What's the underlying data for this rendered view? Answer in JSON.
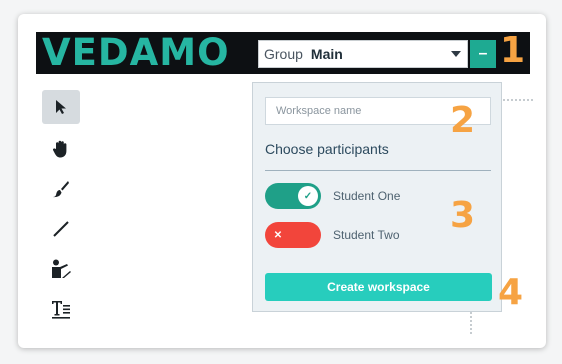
{
  "header": {
    "logo_text": "VEDAMO",
    "group_label": "Group",
    "group_value": "Main",
    "collapse_symbol": "–"
  },
  "callouts": [
    "1",
    "2",
    "3",
    "4"
  ],
  "toolbar": {
    "tools": [
      {
        "icon": "pointer-arrow-icon",
        "active": true
      },
      {
        "icon": "hand-icon",
        "active": false
      },
      {
        "icon": "brush-icon",
        "active": false
      },
      {
        "icon": "line-icon",
        "active": false
      },
      {
        "icon": "presenter-icon",
        "active": false
      },
      {
        "icon": "text-tool-icon",
        "active": false
      }
    ]
  },
  "panel": {
    "workspace_placeholder": "Workspace name",
    "choose_label": "Choose participants",
    "participants": [
      {
        "name": "Student One",
        "enabled": true,
        "color": "#1fa088",
        "mark": "✓"
      },
      {
        "name": "Student Two",
        "enabled": false,
        "color": "#f2453b",
        "mark": "✕"
      }
    ],
    "create_label": "Create workspace"
  },
  "colors": {
    "accent": "#27cdbd",
    "logo": "#26b6a2",
    "callout": "#f6a343",
    "toggle_on": "#1fa088",
    "toggle_off": "#f2453b"
  }
}
